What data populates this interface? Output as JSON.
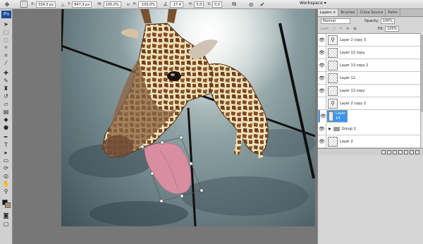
{
  "options_bar": {
    "x_label": "X:",
    "x_value": "334,5 px",
    "y_label": "Y:",
    "y_value": "847,9 px",
    "w_label": "W:",
    "w_value": "100,0%",
    "h_label": "H:",
    "h_value": "-100,0%",
    "angle_value": "-17,4",
    "hskew_label": "H:",
    "hskew_value": "0,0",
    "vskew_label": "V:",
    "vskew_value": "0,0",
    "workspace_label": "Workspace ▾"
  },
  "toolbox": {
    "app_badge": "Ps"
  },
  "panel": {
    "tabs": [
      "Layers ×",
      "Brushes",
      "Clone Source",
      "Paths"
    ],
    "blend_mode": "Normal",
    "opacity_label": "Opacity:",
    "opacity_value": "100%",
    "lock_label": "Lock:",
    "fill_label": "Fill:",
    "fill_value": "100%",
    "layers": [
      {
        "name": "Layer 2 copy 3",
        "thumb": "figure",
        "visible": true
      },
      {
        "name": "Layer 12 copy",
        "thumb": "transparent",
        "visible": true
      },
      {
        "name": "Layer 13 copy 2",
        "thumb": "transparent",
        "visible": true
      },
      {
        "name": "Layer 12",
        "thumb": "transparent",
        "visible": true
      },
      {
        "name": "Layer 13 copy",
        "thumb": "transparent",
        "visible": true
      },
      {
        "name": "Layer 2 copy 2",
        "thumb": "figure",
        "visible": false
      },
      {
        "name": "Layer 14",
        "thumb": "transparent",
        "visible": true,
        "selected": true
      },
      {
        "name": "Group 1",
        "thumb": "folder",
        "visible": true
      },
      {
        "name": "Layer 2",
        "thumb": "transparent",
        "visible": true
      }
    ]
  },
  "colors": {
    "selected_layer": "#3b97e8",
    "ps_badge": "#1c4a8f",
    "sky": "#8fa3a6"
  }
}
